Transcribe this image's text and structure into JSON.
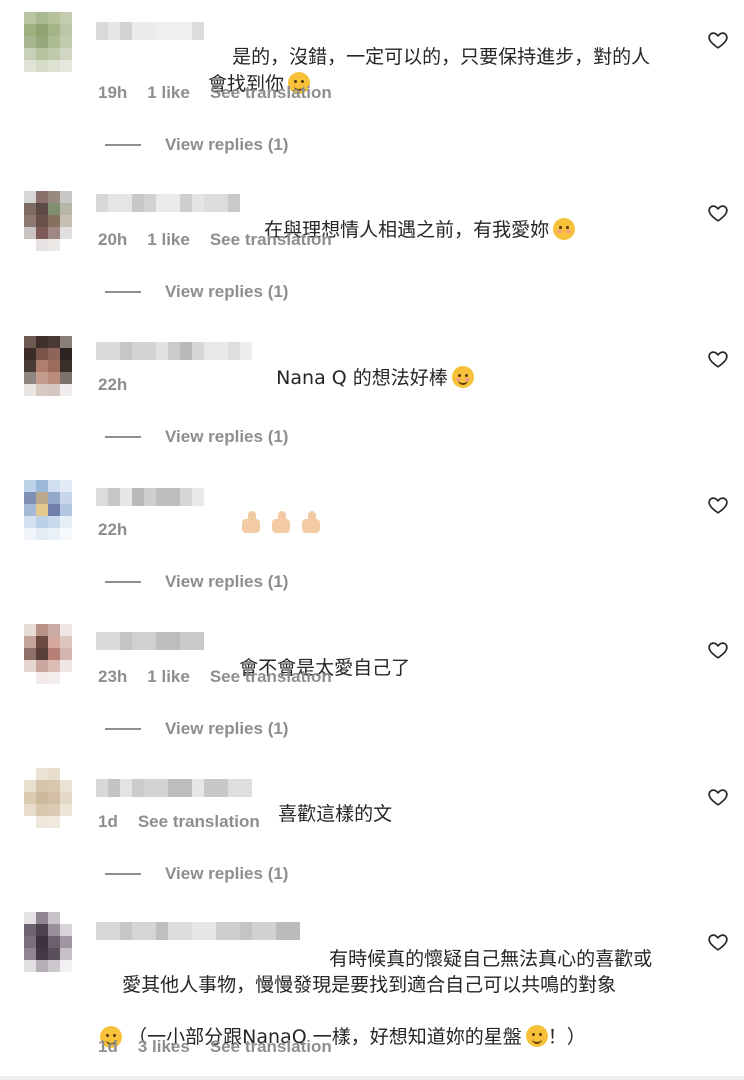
{
  "comments": [
    {
      "text": "是的，沒錯，一定可以的，只要保持進步，對的人\n會找到你",
      "emoji": "smiling-face-icon",
      "time": "19h",
      "likes": "1 like",
      "translate": "See translation",
      "replies": "View replies (1)"
    },
    {
      "text": "在與理想情人相遇之前，有我愛妳",
      "emoji": "face-blowing-kiss-icon",
      "time": "20h",
      "likes": "1 like",
      "translate": "See translation",
      "replies": "View replies (1)"
    },
    {
      "text": "Nana Q 的想法好棒",
      "emoji": "smiling-face-blush-icon",
      "time": "22h",
      "replies": "View replies (1)"
    },
    {
      "text": "",
      "emoji": "thumbs-up-icon ×3",
      "time": "22h",
      "replies": "View replies (1)"
    },
    {
      "text": "會不會是太愛自己了",
      "time": "23h",
      "likes": "1 like",
      "translate": "See translation",
      "replies": "View replies (1)"
    },
    {
      "text": "喜歡這樣的文",
      "time": "1d",
      "translate": "See translation",
      "replies": "View replies (1)"
    },
    {
      "text_l1": "有時候真的懷疑自己無法真心的喜歡或",
      "text_l2": "愛其他人事物，慢慢發現是要找到適合自己可以共鳴的對象",
      "text_l4": "（一小部分跟NanaQ 一樣，好想知道妳的星盤",
      "text_l4_end": "！）",
      "emoji": "pleading-face-icon",
      "emoji2": "rolling-laughing-face-icon",
      "time": "1d",
      "likes": "3 likes",
      "translate": "See translation"
    }
  ],
  "colors": {
    "text": "#262626",
    "meta": "#8e8e8e",
    "background": "#ffffff"
  }
}
